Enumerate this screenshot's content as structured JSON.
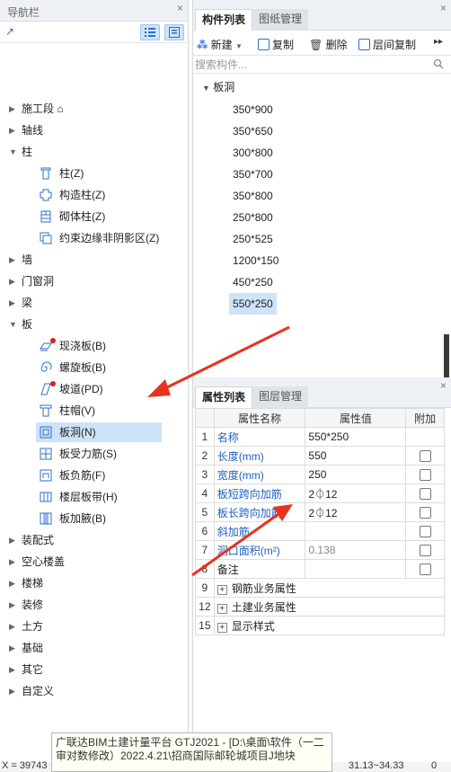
{
  "nav": {
    "title": "导航栏",
    "close": "×",
    "toolbar_left": "↗",
    "tree": [
      {
        "label": "施工段 ⌂",
        "expanded": false
      },
      {
        "label": "轴线",
        "expanded": false
      },
      {
        "label": "柱",
        "expanded": true
      },
      {
        "label": "墙",
        "expanded": false
      },
      {
        "label": "门窗洞",
        "expanded": false
      },
      {
        "label": "梁",
        "expanded": false
      },
      {
        "label": "板",
        "expanded": true
      },
      {
        "label": "装配式",
        "expanded": false
      },
      {
        "label": "空心楼盖",
        "expanded": false
      },
      {
        "label": "楼梯",
        "expanded": false
      },
      {
        "label": "装修",
        "expanded": false
      },
      {
        "label": "土方",
        "expanded": false
      },
      {
        "label": "基础",
        "expanded": false
      },
      {
        "label": "其它",
        "expanded": false
      },
      {
        "label": "自定义",
        "expanded": false
      }
    ],
    "column_children": [
      "柱(Z)",
      "构造柱(Z)",
      "砌体柱(Z)",
      "约束边缘非阴影区(Z)"
    ],
    "slab_children": [
      "现浇板(B)",
      "螺旋板(B)",
      "坡道(PD)",
      "柱帽(V)",
      "板洞(N)",
      "板受力筋(S)",
      "板负筋(F)",
      "楼层板带(H)",
      "板加腋(B)"
    ]
  },
  "components": {
    "tabs": [
      "构件列表",
      "图纸管理"
    ],
    "toolbar": {
      "new": "新建",
      "copy": "复制",
      "delete": "删除",
      "floor_copy": "层间复制"
    },
    "search_placeholder": "搜索构件...",
    "group": "板洞",
    "items": [
      "350*900",
      "350*650",
      "300*800",
      "350*700",
      "350*800",
      "250*800",
      "250*525",
      "1200*150",
      "450*250",
      "550*250"
    ],
    "selected": "550*250"
  },
  "properties": {
    "tabs": [
      "属性列表",
      "图层管理"
    ],
    "headers": [
      "属性名称",
      "属性值",
      "附加"
    ],
    "rows": [
      {
        "n": "1",
        "name": "名称",
        "value": "550*250"
      },
      {
        "n": "2",
        "name": "长度(mm)",
        "value": "550"
      },
      {
        "n": "3",
        "name": "宽度(mm)",
        "value": "250"
      },
      {
        "n": "4",
        "name": "板短跨向加筋",
        "value": "2⏀12"
      },
      {
        "n": "5",
        "name": "板长跨向加筋",
        "value": "2⏀12"
      },
      {
        "n": "6",
        "name": "斜加筋",
        "value": ""
      },
      {
        "n": "7",
        "name": "洞口面积(m²)",
        "value": "0.138"
      },
      {
        "n": "8",
        "name": "备注",
        "value": ""
      },
      {
        "n": "9",
        "name": "钢筋业务属性",
        "value": ""
      },
      {
        "n": "12",
        "name": "土建业务属性",
        "value": ""
      },
      {
        "n": "15",
        "name": "显示样式",
        "value": ""
      }
    ]
  },
  "tooltip": "广联达BIM土建计量平台 GTJ2021 - [D:\\桌面\\软件（一二审对数修改）2022.4.21\\招商国际邮轮城项目J地块",
  "statusbar": {
    "left": "X = 39743",
    "right": "31.13~34.33",
    "far": "0"
  },
  "colors": {
    "accent": "#2d6fcf",
    "selected": "#cde3f8",
    "annotation_arrow": "#e8321e"
  }
}
